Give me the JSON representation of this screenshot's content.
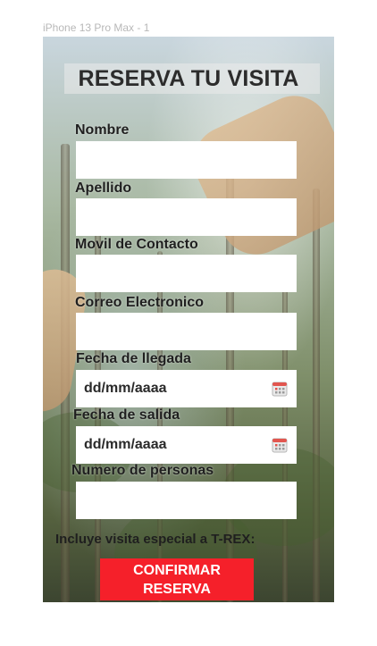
{
  "artboard": {
    "label": "iPhone 13 Pro Max - 1"
  },
  "header": {
    "title": "RESERVA TU VISITA"
  },
  "form": {
    "fields": [
      {
        "label": "Nombre",
        "value": ""
      },
      {
        "label": "Apellido",
        "value": ""
      },
      {
        "label": "Movil de Contacto",
        "value": ""
      },
      {
        "label": "Correo Electronico",
        "value": ""
      },
      {
        "label": "Fecha de llegada",
        "value": "dd/mm/aaaa"
      },
      {
        "label": "Fecha de salida",
        "value": "dd/mm/aaaa"
      },
      {
        "label": "Numero de personas",
        "value": ""
      }
    ],
    "calendar_icon": "calendar-icon"
  },
  "note": "Incluye visita especial a  T-REX:",
  "confirm": {
    "line1": "CONFIRMAR",
    "line2": "RESERVA",
    "color": "#f5202a"
  }
}
